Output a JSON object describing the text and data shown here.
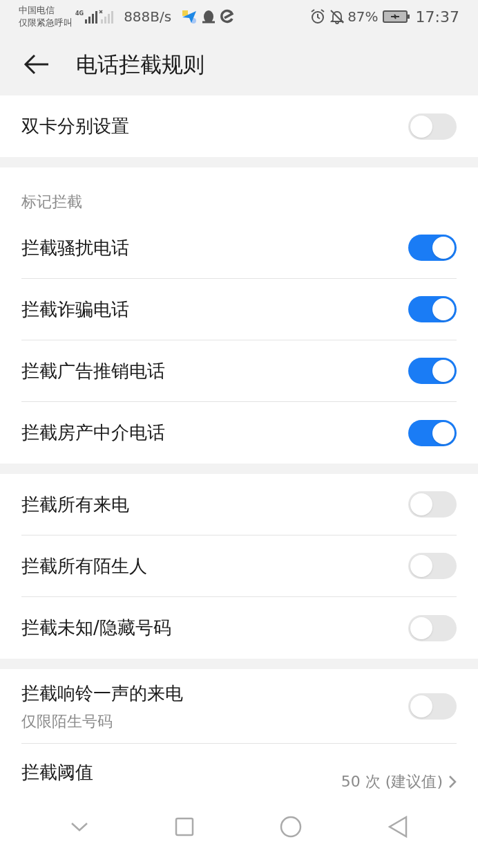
{
  "status_bar": {
    "carrier": "中国电信",
    "carrier_note": "仅限紧急呼叫",
    "network": "4G",
    "speed": "888B/s",
    "battery": "87%",
    "time": "17:37"
  },
  "header": {
    "title": "电话拦截规则"
  },
  "sections": [
    {
      "items": [
        {
          "kind": "toggle",
          "label": "双卡分别设置",
          "on": false
        }
      ]
    },
    {
      "heading": "标记拦截",
      "items": [
        {
          "kind": "toggle",
          "label": "拦截骚扰电话",
          "on": true
        },
        {
          "kind": "toggle",
          "label": "拦截诈骗电话",
          "on": true
        },
        {
          "kind": "toggle",
          "label": "拦截广告推销电话",
          "on": true
        },
        {
          "kind": "toggle",
          "label": "拦截房产中介电话",
          "on": true
        }
      ]
    },
    {
      "items": [
        {
          "kind": "toggle",
          "label": "拦截所有来电",
          "on": false
        },
        {
          "kind": "toggle",
          "label": "拦截所有陌生人",
          "on": false
        },
        {
          "kind": "toggle",
          "label": "拦截未知/隐藏号码",
          "on": false
        }
      ]
    },
    {
      "items": [
        {
          "kind": "toggle",
          "label": "拦截响铃一声的来电",
          "sublabel": "仅限陌生号码",
          "on": false
        },
        {
          "kind": "value",
          "label": "拦截阈值",
          "value": "50 次 (建议值)"
        }
      ]
    }
  ]
}
